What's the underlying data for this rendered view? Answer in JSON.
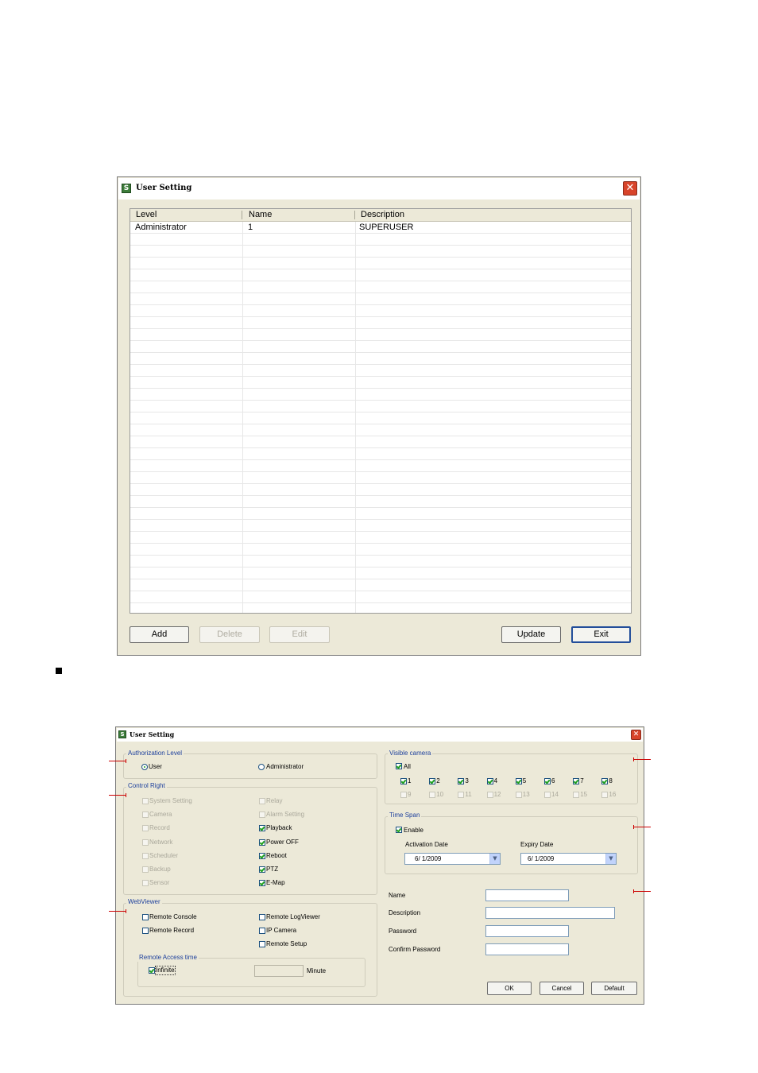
{
  "window1": {
    "title": "User Setting",
    "columns": [
      "Level",
      "Name",
      "Description"
    ],
    "rows": [
      {
        "level": "Administrator",
        "name": "1",
        "description": "SUPERUSER"
      }
    ],
    "buttons": {
      "add": "Add",
      "delete": "Delete",
      "edit": "Edit",
      "update": "Update",
      "exit": "Exit"
    }
  },
  "window2": {
    "title": "User Setting",
    "authorization": {
      "label": "Authorization Level",
      "options": [
        {
          "label": "User",
          "selected": true
        },
        {
          "label": "Administrator",
          "selected": false
        }
      ]
    },
    "control_right": {
      "label": "Control Right",
      "left": [
        {
          "label": "System Setting",
          "checked": false,
          "enabled": false
        },
        {
          "label": "Camera",
          "checked": false,
          "enabled": false
        },
        {
          "label": "Record",
          "checked": false,
          "enabled": false
        },
        {
          "label": "Network",
          "checked": false,
          "enabled": false
        },
        {
          "label": "Scheduler",
          "checked": false,
          "enabled": false
        },
        {
          "label": "Backup",
          "checked": false,
          "enabled": false
        },
        {
          "label": "Sensor",
          "checked": false,
          "enabled": false
        }
      ],
      "right": [
        {
          "label": "Relay",
          "checked": false,
          "enabled": false
        },
        {
          "label": "Alarm Setting",
          "checked": false,
          "enabled": false
        },
        {
          "label": "Playback",
          "checked": true,
          "enabled": true
        },
        {
          "label": "Power OFF",
          "checked": true,
          "enabled": true
        },
        {
          "label": "Reboot",
          "checked": true,
          "enabled": true
        },
        {
          "label": "PTZ",
          "checked": true,
          "enabled": true
        },
        {
          "label": "E-Map",
          "checked": true,
          "enabled": true
        }
      ]
    },
    "webviewer": {
      "label": "WebViewer",
      "items": [
        {
          "label": "Remote Console",
          "checked": false
        },
        {
          "label": "Remote LogViewer",
          "checked": false
        },
        {
          "label": "Remote Record",
          "checked": false
        },
        {
          "label": "IP Camera",
          "checked": false
        },
        {
          "label": "Remote Setup",
          "checked": false
        }
      ],
      "remote_access": {
        "label": "Remote Access time",
        "infinite_label": "Infinite",
        "infinite_checked": true,
        "minute_label": "Minute",
        "minute_value": ""
      }
    },
    "visible_camera": {
      "label": "Visible camera",
      "all_label": "All",
      "all_checked": true,
      "cameras": [
        {
          "label": "1",
          "checked": true,
          "enabled": true
        },
        {
          "label": "2",
          "checked": true,
          "enabled": true
        },
        {
          "label": "3",
          "checked": true,
          "enabled": true
        },
        {
          "label": "4",
          "checked": true,
          "enabled": true
        },
        {
          "label": "5",
          "checked": true,
          "enabled": true
        },
        {
          "label": "6",
          "checked": true,
          "enabled": true
        },
        {
          "label": "7",
          "checked": true,
          "enabled": true
        },
        {
          "label": "8",
          "checked": true,
          "enabled": true
        },
        {
          "label": "9",
          "checked": false,
          "enabled": false
        },
        {
          "label": "10",
          "checked": false,
          "enabled": false
        },
        {
          "label": "11",
          "checked": false,
          "enabled": false
        },
        {
          "label": "12",
          "checked": false,
          "enabled": false
        },
        {
          "label": "13",
          "checked": false,
          "enabled": false
        },
        {
          "label": "14",
          "checked": false,
          "enabled": false
        },
        {
          "label": "15",
          "checked": false,
          "enabled": false
        },
        {
          "label": "16",
          "checked": false,
          "enabled": false
        }
      ]
    },
    "time_span": {
      "label": "Time Span",
      "enable_label": "Enable",
      "enable_checked": true,
      "activation_label": "Activation Date",
      "activation_value": "6/ 1/2009",
      "expiry_label": "Expiry Date",
      "expiry_value": "6/ 1/2009"
    },
    "fields": {
      "name_label": "Name",
      "name_value": "",
      "description_label": "Description",
      "description_value": "",
      "password_label": "Password",
      "password_value": "",
      "confirm_label": "Confirm Password",
      "confirm_value": ""
    },
    "buttons": {
      "ok": "OK",
      "cancel": "Cancel",
      "default": "Default"
    }
  },
  "colors": {
    "dialog_bg": "#ece9d8",
    "group_label": "#1c3f9c",
    "close_button": "#d8442a",
    "callout": "#cc0000",
    "check_mark": "#21a121"
  }
}
